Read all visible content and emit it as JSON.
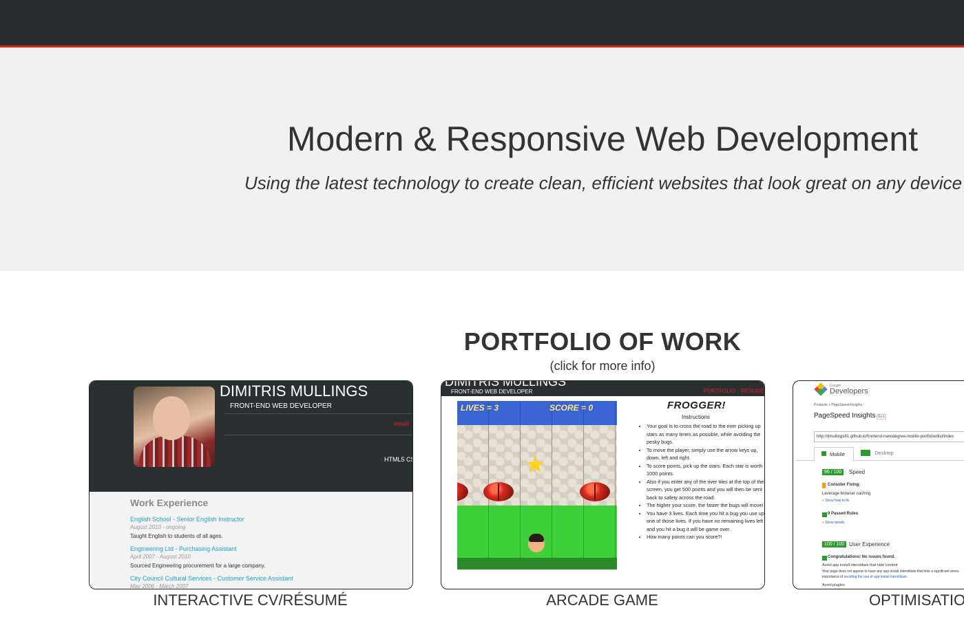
{
  "hero": {
    "title": "Modern & Responsive Web Development",
    "subtitle": "Using the latest technology to create clean, efficient websites that look great on any device"
  },
  "portfolio": {
    "title": "PORTFOLIO OF WORK",
    "subtitle": "(click for more info)"
  },
  "cards": [
    {
      "caption": "INTERACTIVE CV/RÉSUMÉ",
      "name": "DIMITRIS MULLINGS",
      "role": "FRONT-END WEB DEVELOPER",
      "email": "email",
      "skills": "HTML5 CS",
      "section": "Work Experience",
      "jobs": [
        {
          "title": "English School - Senior English Instructor",
          "date": "August 2010 - ongoing",
          "desc": "Taught English to students of all ages."
        },
        {
          "title": "Engineering Ltd - Purchasing Assistant",
          "date": "April 2007 - August 2010",
          "desc": "Sourced Engineering procurement for a large company."
        },
        {
          "title": "City Council Cultural Services - Customer Service Assistant",
          "date": "May 2006 - March 2007"
        }
      ]
    },
    {
      "caption": "ARCADE GAME",
      "name": "DIMITRIS MULLINGS",
      "role": "FRONT-END WEB DEVELOPER",
      "nav": [
        "PORTFOLIO",
        "RÉSUMÉ"
      ],
      "lives": "LIVES = 3",
      "score": "SCORE = 0",
      "game_title": "FROGGER!",
      "instructions_label": "Instructions",
      "instructions": [
        "Your goal is to cross the road to the river picking up stars as many times as possible, while avoiding the pesky bugs.",
        "To move the player, simply use the arrow keys up, down, left and right.",
        "To score points, pick up the stars. Each star is worth 1000 points.",
        "Also if you enter any of the river tiles at the top of the screen, you get 500 points and you will then be sent back to safety across the road.",
        "The higher your score, the faster the bugs will move!",
        "You have 3 lives. Each time you hit a bug you use up one of those lives. If you have no remaining lives left and you hit a bug it will be game over.",
        "How many points can you score?!"
      ]
    },
    {
      "caption": "OPTIMISATION",
      "brand_small": "Google",
      "brand": "Developers",
      "breadcrumb": "Products  >  PageSpeed Insights",
      "page_title": "PageSpeed Insights",
      "gplus": "G+1",
      "url": "http://dmullings81.github.io/frontend-nanodegree-mobile-portfolio/dist/index",
      "tabs": [
        "Mobile",
        "Desktop"
      ],
      "speed_score": "96 / 100",
      "speed_label": "Speed",
      "consider": "Consider Fixing:",
      "leverage": "Leverage browser caching",
      "show_fix": "» Show how to fix",
      "passed": "9 Passed Rules",
      "show_details": "» Show details",
      "ux_score": "100 / 100",
      "ux_label": "User Experience",
      "congrats": "Congratulations! No issues found.",
      "avoid1": "Avoid app install interstitials that hide content",
      "avoid_desc": "Your page does not appear to have any app install interstitials that hide a significant amou",
      "importance_pre": "importance of ",
      "importance_link": "avoiding the use of app install interstitials.",
      "avoid2": "Avoid plugins"
    }
  ],
  "colors": {
    "navbar": "#252b2e",
    "accent": "#e21d1d",
    "hero_bg": "#f1f1f1",
    "link": "#1aa3cf"
  }
}
